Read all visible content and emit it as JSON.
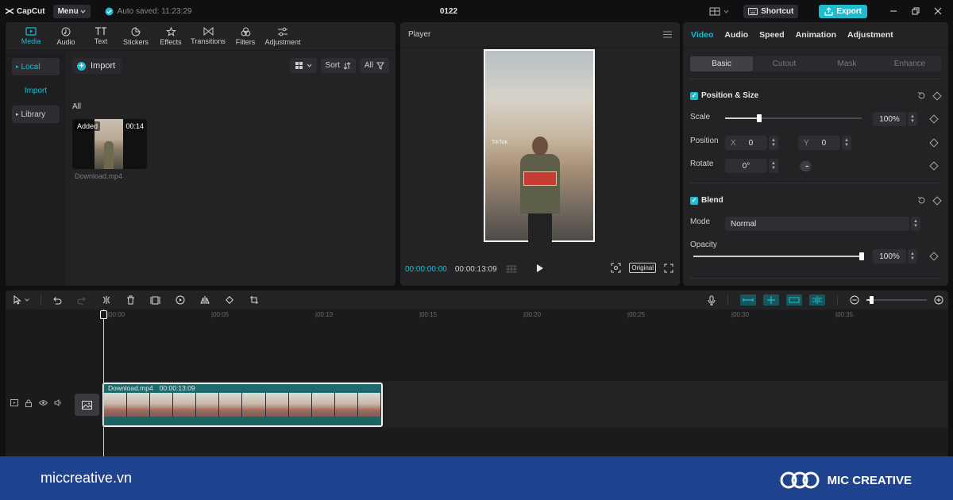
{
  "titlebar": {
    "app_name": "CapCut",
    "menu_label": "Menu",
    "autosave": "Auto saved: 11:23:29",
    "project_title": "0122",
    "shortcut_label": "Shortcut",
    "export_label": "Export"
  },
  "media": {
    "tabs": [
      {
        "label": "Media",
        "icon": "media-icon"
      },
      {
        "label": "Audio",
        "icon": "audio-icon"
      },
      {
        "label": "Text",
        "icon": "text-icon"
      },
      {
        "label": "Stickers",
        "icon": "stickers-icon"
      },
      {
        "label": "Effects",
        "icon": "effects-icon"
      },
      {
        "label": "Transitions",
        "icon": "transitions-icon"
      },
      {
        "label": "Filters",
        "icon": "filters-icon"
      },
      {
        "label": "Adjustment",
        "icon": "adjustment-icon"
      }
    ],
    "sidebar": {
      "local": "Local",
      "import": "Import",
      "library": "Library"
    },
    "import_button": "Import",
    "sort_label": "Sort",
    "all_filter": "All",
    "section_label": "All",
    "clip": {
      "badge": "Added",
      "duration": "00:14",
      "filename": "Download.mp4"
    }
  },
  "player": {
    "title": "Player",
    "watermark": "TikTok",
    "current_time": "00:00:00:00",
    "total_time": "00:00:13:09",
    "original_label": "Original"
  },
  "properties": {
    "tabs": [
      "Video",
      "Audio",
      "Speed",
      "Animation",
      "Adjustment"
    ],
    "sub_tabs": [
      "Basic",
      "Cutout",
      "Mask",
      "Enhance"
    ],
    "position_size": {
      "title": "Position & Size",
      "scale_label": "Scale",
      "scale_value": "100%",
      "scale_level": 0.25,
      "position_label": "Position",
      "x_label": "X",
      "x_value": "0",
      "y_label": "Y",
      "y_value": "0",
      "rotate_label": "Rotate",
      "rotate_value": "0°"
    },
    "blend": {
      "title": "Blend",
      "mode_label": "Mode",
      "mode_value": "Normal",
      "opacity_label": "Opacity",
      "opacity_value": "100%",
      "opacity_level": 1.0
    }
  },
  "timeline": {
    "ruler_labels": [
      "00:00",
      "00:05",
      "00:10",
      "00:15",
      "00:20",
      "00:25",
      "00:30",
      "00:35"
    ],
    "clip_name": "Download.mp4",
    "clip_duration": "00:00:13:09"
  },
  "footer": {
    "website": "miccreative.vn",
    "brand": "MIC CREATIVE"
  },
  "colors": {
    "accent": "#1fbbcf",
    "panel": "#232326",
    "background": "#101012",
    "footer": "#20438f"
  }
}
